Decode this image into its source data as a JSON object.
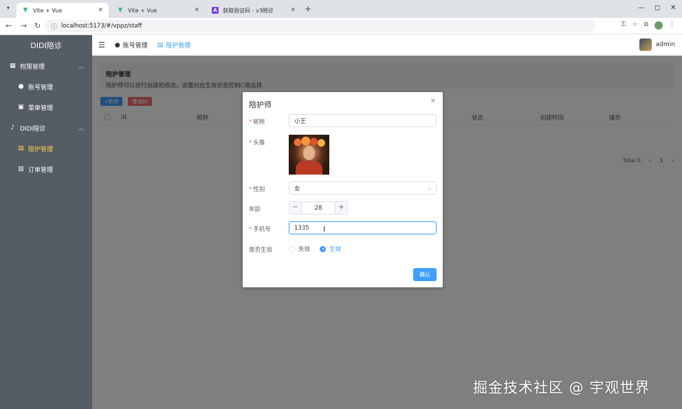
{
  "browser": {
    "tabs": [
      {
        "title": "Vite + Vue",
        "icon": "vite-icon",
        "active": true
      },
      {
        "title": "Vite + Vue",
        "icon": "vite-icon",
        "active": false
      },
      {
        "title": "获取验证码 - v3陪诊",
        "icon": "apifox-icon",
        "active": false
      }
    ],
    "url": "localhost:5173/#/vppz/staff"
  },
  "sidebar": {
    "brand": "DIDI陪诊",
    "groups": [
      {
        "label": "权限管理",
        "icon": "grid-icon",
        "items": [
          {
            "label": "账号管理",
            "icon": "user-icon",
            "active": false
          },
          {
            "label": "菜单管理",
            "icon": "menu-icon",
            "active": false
          }
        ]
      },
      {
        "label": "DIDI陪诊",
        "icon": "bell-icon",
        "items": [
          {
            "label": "陪护管理",
            "icon": "document-icon",
            "active": true
          },
          {
            "label": "订单管理",
            "icon": "list-icon",
            "active": false
          }
        ]
      }
    ]
  },
  "header": {
    "tabs": [
      {
        "label": "账号管理",
        "active": false
      },
      {
        "label": "陪护管理",
        "active": true
      }
    ],
    "username": "admin"
  },
  "main": {
    "notice_title": "陪护管理",
    "notice_desc": "陪护师可以进行创建和修改，设置对应生效状态控制C端选择",
    "add_button": "新增",
    "delete_button": "删除",
    "columns": [
      "id",
      "昵称",
      "状态",
      "创建时间",
      "操作"
    ],
    "total": "Total 0",
    "page": "1"
  },
  "dialog": {
    "title": "陪护师",
    "fields": {
      "nickname_label": "昵称",
      "nickname_value": "小王",
      "avatar_label": "头像",
      "gender_label": "性别",
      "gender_value": "女",
      "age_label": "年龄",
      "age_value": "28",
      "phone_label": "手机号",
      "phone_value": "1335",
      "active_label": "是否生效",
      "active_options": [
        "失效",
        "生效"
      ],
      "active_selected": "生效"
    },
    "confirm": "确认"
  },
  "watermark": "掘金技术社区 @ 宇观世界",
  "colors": {
    "primary": "#409eff",
    "danger": "#f56c6c",
    "sidebar_bg": "#545c64",
    "active_menu": "#ffd04b"
  }
}
